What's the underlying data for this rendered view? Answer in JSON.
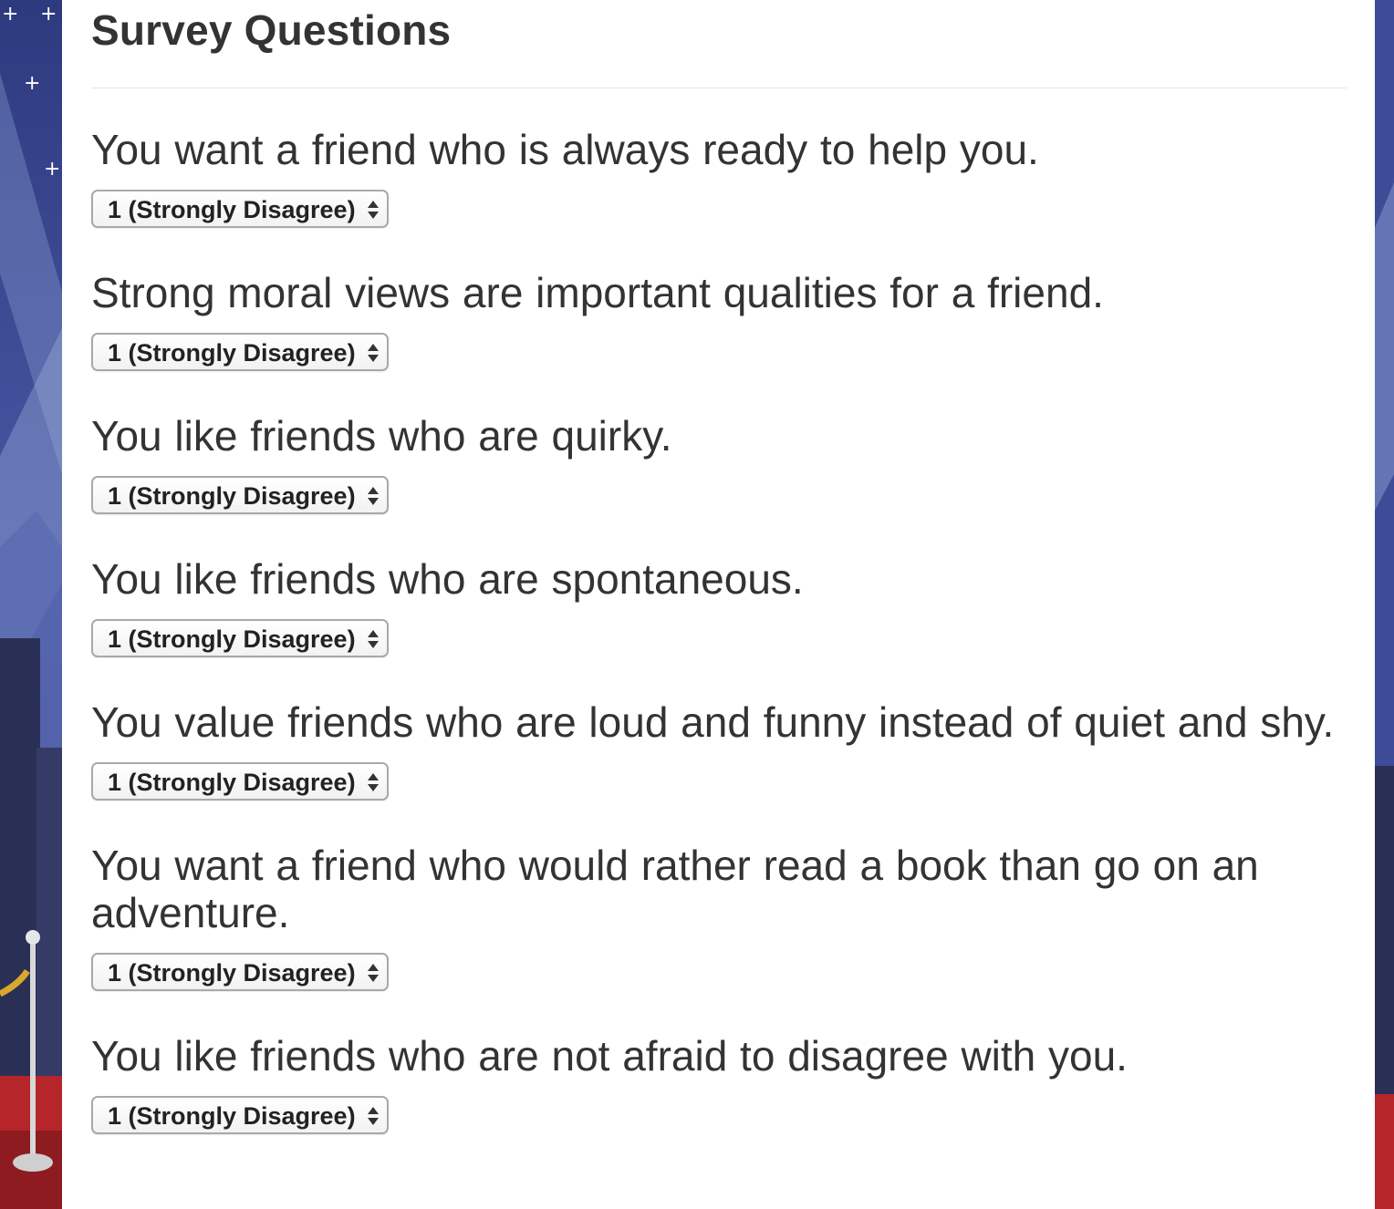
{
  "survey": {
    "title": "Survey Questions",
    "questions": [
      {
        "text": "You want a friend who is always ready to help you.",
        "selected": "1 (Strongly Disagree)"
      },
      {
        "text": "Strong moral views are important qualities for a friend.",
        "selected": "1 (Strongly Disagree)"
      },
      {
        "text": "You like friends who are quirky.",
        "selected": "1 (Strongly Disagree)"
      },
      {
        "text": "You like friends who are spontaneous.",
        "selected": "1 (Strongly Disagree)"
      },
      {
        "text": "You value friends who are loud and funny instead of quiet and shy.",
        "selected": "1 (Strongly Disagree)"
      },
      {
        "text": "You want a friend who would rather read a book than go on an adventure.",
        "selected": "1 (Strongly Disagree)"
      },
      {
        "text": "You like friends who are not afraid to disagree with you.",
        "selected": "1 (Strongly Disagree)"
      }
    ]
  },
  "icons": {
    "select_arrows": "updown-arrows-icon"
  }
}
